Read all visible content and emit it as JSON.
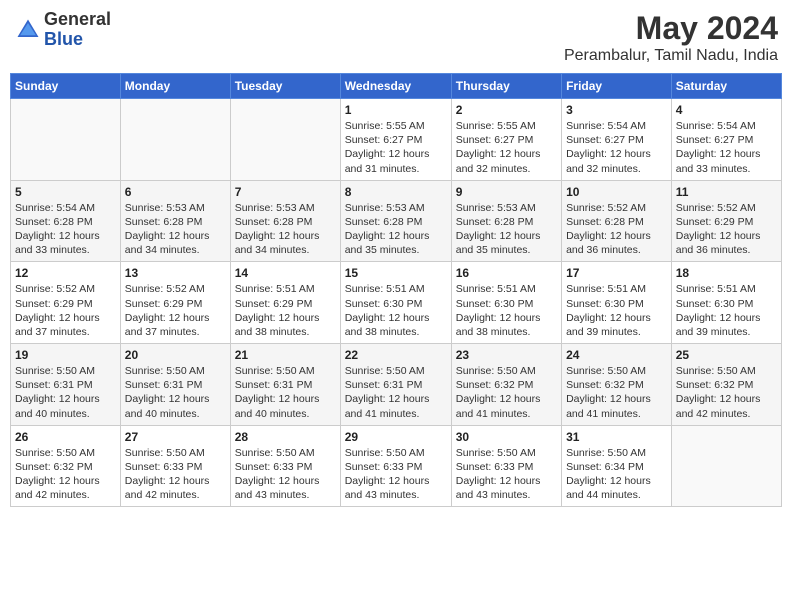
{
  "header": {
    "logo_line1": "General",
    "logo_line2": "Blue",
    "title": "May 2024",
    "subtitle": "Perambalur, Tamil Nadu, India"
  },
  "weekdays": [
    "Sunday",
    "Monday",
    "Tuesday",
    "Wednesday",
    "Thursday",
    "Friday",
    "Saturday"
  ],
  "weeks": [
    [
      {
        "day": "",
        "info": ""
      },
      {
        "day": "",
        "info": ""
      },
      {
        "day": "",
        "info": ""
      },
      {
        "day": "1",
        "info": "Sunrise: 5:55 AM\nSunset: 6:27 PM\nDaylight: 12 hours\nand 31 minutes."
      },
      {
        "day": "2",
        "info": "Sunrise: 5:55 AM\nSunset: 6:27 PM\nDaylight: 12 hours\nand 32 minutes."
      },
      {
        "day": "3",
        "info": "Sunrise: 5:54 AM\nSunset: 6:27 PM\nDaylight: 12 hours\nand 32 minutes."
      },
      {
        "day": "4",
        "info": "Sunrise: 5:54 AM\nSunset: 6:27 PM\nDaylight: 12 hours\nand 33 minutes."
      }
    ],
    [
      {
        "day": "5",
        "info": "Sunrise: 5:54 AM\nSunset: 6:28 PM\nDaylight: 12 hours\nand 33 minutes."
      },
      {
        "day": "6",
        "info": "Sunrise: 5:53 AM\nSunset: 6:28 PM\nDaylight: 12 hours\nand 34 minutes."
      },
      {
        "day": "7",
        "info": "Sunrise: 5:53 AM\nSunset: 6:28 PM\nDaylight: 12 hours\nand 34 minutes."
      },
      {
        "day": "8",
        "info": "Sunrise: 5:53 AM\nSunset: 6:28 PM\nDaylight: 12 hours\nand 35 minutes."
      },
      {
        "day": "9",
        "info": "Sunrise: 5:53 AM\nSunset: 6:28 PM\nDaylight: 12 hours\nand 35 minutes."
      },
      {
        "day": "10",
        "info": "Sunrise: 5:52 AM\nSunset: 6:28 PM\nDaylight: 12 hours\nand 36 minutes."
      },
      {
        "day": "11",
        "info": "Sunrise: 5:52 AM\nSunset: 6:29 PM\nDaylight: 12 hours\nand 36 minutes."
      }
    ],
    [
      {
        "day": "12",
        "info": "Sunrise: 5:52 AM\nSunset: 6:29 PM\nDaylight: 12 hours\nand 37 minutes."
      },
      {
        "day": "13",
        "info": "Sunrise: 5:52 AM\nSunset: 6:29 PM\nDaylight: 12 hours\nand 37 minutes."
      },
      {
        "day": "14",
        "info": "Sunrise: 5:51 AM\nSunset: 6:29 PM\nDaylight: 12 hours\nand 38 minutes."
      },
      {
        "day": "15",
        "info": "Sunrise: 5:51 AM\nSunset: 6:30 PM\nDaylight: 12 hours\nand 38 minutes."
      },
      {
        "day": "16",
        "info": "Sunrise: 5:51 AM\nSunset: 6:30 PM\nDaylight: 12 hours\nand 38 minutes."
      },
      {
        "day": "17",
        "info": "Sunrise: 5:51 AM\nSunset: 6:30 PM\nDaylight: 12 hours\nand 39 minutes."
      },
      {
        "day": "18",
        "info": "Sunrise: 5:51 AM\nSunset: 6:30 PM\nDaylight: 12 hours\nand 39 minutes."
      }
    ],
    [
      {
        "day": "19",
        "info": "Sunrise: 5:50 AM\nSunset: 6:31 PM\nDaylight: 12 hours\nand 40 minutes."
      },
      {
        "day": "20",
        "info": "Sunrise: 5:50 AM\nSunset: 6:31 PM\nDaylight: 12 hours\nand 40 minutes."
      },
      {
        "day": "21",
        "info": "Sunrise: 5:50 AM\nSunset: 6:31 PM\nDaylight: 12 hours\nand 40 minutes."
      },
      {
        "day": "22",
        "info": "Sunrise: 5:50 AM\nSunset: 6:31 PM\nDaylight: 12 hours\nand 41 minutes."
      },
      {
        "day": "23",
        "info": "Sunrise: 5:50 AM\nSunset: 6:32 PM\nDaylight: 12 hours\nand 41 minutes."
      },
      {
        "day": "24",
        "info": "Sunrise: 5:50 AM\nSunset: 6:32 PM\nDaylight: 12 hours\nand 41 minutes."
      },
      {
        "day": "25",
        "info": "Sunrise: 5:50 AM\nSunset: 6:32 PM\nDaylight: 12 hours\nand 42 minutes."
      }
    ],
    [
      {
        "day": "26",
        "info": "Sunrise: 5:50 AM\nSunset: 6:32 PM\nDaylight: 12 hours\nand 42 minutes."
      },
      {
        "day": "27",
        "info": "Sunrise: 5:50 AM\nSunset: 6:33 PM\nDaylight: 12 hours\nand 42 minutes."
      },
      {
        "day": "28",
        "info": "Sunrise: 5:50 AM\nSunset: 6:33 PM\nDaylight: 12 hours\nand 43 minutes."
      },
      {
        "day": "29",
        "info": "Sunrise: 5:50 AM\nSunset: 6:33 PM\nDaylight: 12 hours\nand 43 minutes."
      },
      {
        "day": "30",
        "info": "Sunrise: 5:50 AM\nSunset: 6:33 PM\nDaylight: 12 hours\nand 43 minutes."
      },
      {
        "day": "31",
        "info": "Sunrise: 5:50 AM\nSunset: 6:34 PM\nDaylight: 12 hours\nand 44 minutes."
      },
      {
        "day": "",
        "info": ""
      }
    ]
  ]
}
